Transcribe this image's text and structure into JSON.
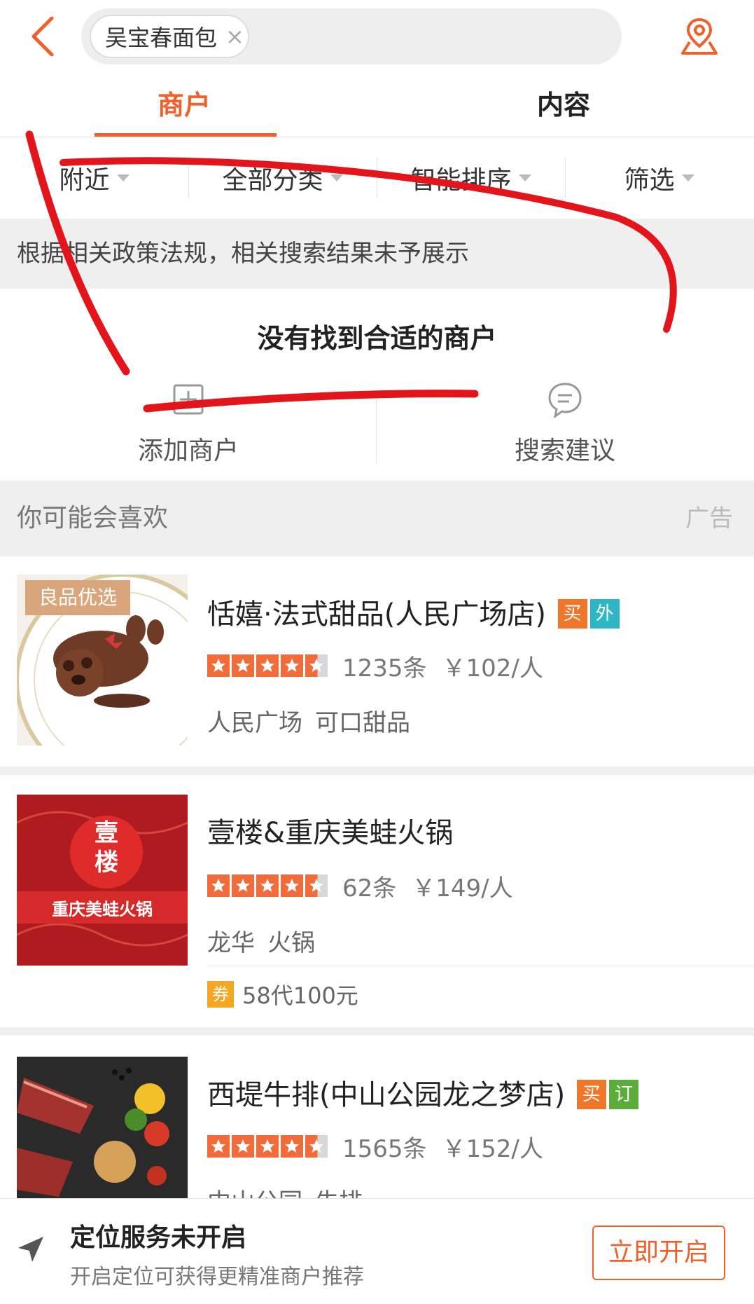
{
  "search": {
    "chip_text": "吴宝春面包",
    "chip_close": "×"
  },
  "tabs": [
    {
      "label": "商户"
    },
    {
      "label": "内容"
    }
  ],
  "filters": [
    {
      "label": "附近"
    },
    {
      "label": "全部分类"
    },
    {
      "label": "智能排序"
    },
    {
      "label": "筛选"
    }
  ],
  "notice": "根据相关政策法规，相关搜索结果未予展示",
  "empty": {
    "title": "没有找到合适的商户",
    "add_label": "添加商户",
    "suggest_label": "搜索建议"
  },
  "recommend": {
    "title": "你可能会喜欢",
    "ad_label": "广告"
  },
  "listings": [
    {
      "ribbon": "良品优选",
      "name": "恬嬉·法式甜品(人民广场店)",
      "badges": [
        "买",
        "外"
      ],
      "rating": 4.5,
      "reviews": "1235条",
      "price": "￥102/人",
      "area": "人民广场",
      "category": "可口甜品"
    },
    {
      "name": "壹楼&重庆美蛙火锅",
      "thumb_text": {
        "big1": "壹",
        "big2": "楼",
        "banner": "重庆美蛙火锅"
      },
      "rating": 4.5,
      "reviews": "62条",
      "price": "￥149/人",
      "area": "龙华",
      "category": "火锅",
      "deal_badge": "券",
      "deal": "58代100元"
    },
    {
      "name": "西堤牛排(中山公园龙之梦店)",
      "badges": [
        "买",
        "订"
      ],
      "rating": 4.5,
      "reviews": "1565条",
      "price": "￥152/人",
      "area": "中山公园",
      "category": "牛排"
    }
  ],
  "location_bar": {
    "title": "定位服务未开启",
    "subtitle": "开启定位可获得更精准商户推荐",
    "button": "立即开启"
  },
  "colors": {
    "accent": "#f0602a",
    "scribble": "#e4141b"
  }
}
